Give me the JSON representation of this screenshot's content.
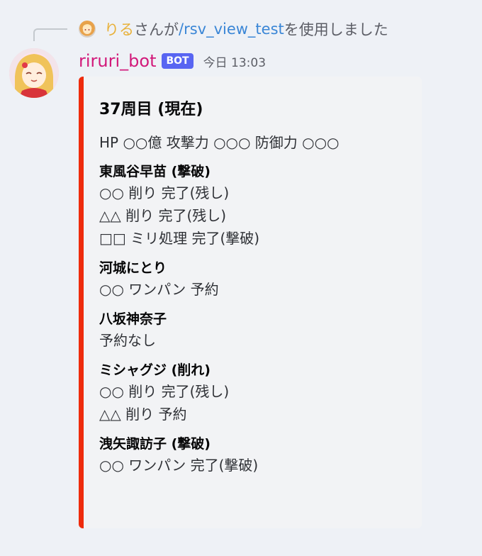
{
  "reference": {
    "user": "りる",
    "text_mid": "さんが",
    "command": "/rsv_view_test",
    "text_end": "を使用しました"
  },
  "message": {
    "author": "riruri_bot",
    "bot_tag": "BOT",
    "timestamp": "今日 13:03"
  },
  "embed": {
    "accent_color": "#ee2b0c",
    "title": "37周目 (現在)",
    "description": "HP ○○億 攻撃力 ○○○ 防御力 ○○○",
    "fields": [
      {
        "name": "東風谷早苗 (撃破)",
        "lines": [
          "○○ 削り 完了(残し)",
          "△△ 削り 完了(残し)",
          "□□ ミリ処理 完了(撃破)"
        ]
      },
      {
        "name": "河城にとり",
        "lines": [
          "○○ ワンパン 予約"
        ]
      },
      {
        "name": "八坂神奈子",
        "lines": [
          "予約なし"
        ]
      },
      {
        "name": "ミシャグジ (削れ)",
        "lines": [
          "○○ 削り 完了(残し)",
          "△△ 削り 予約"
        ]
      },
      {
        "name": "洩矢諏訪子 (撃破)",
        "lines": [
          "○○ ワンパン 完了(撃破)"
        ]
      }
    ]
  }
}
